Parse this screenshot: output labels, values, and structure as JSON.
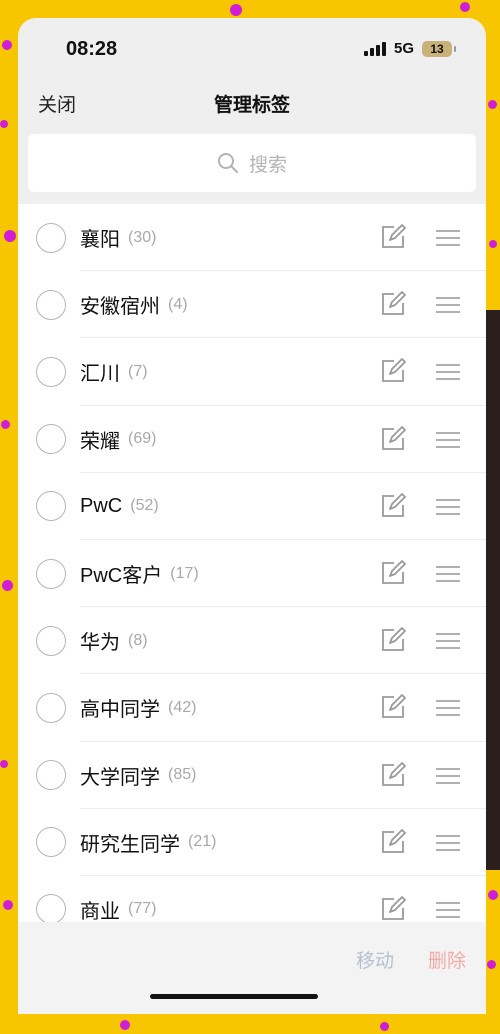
{
  "status_bar": {
    "time": "08:28",
    "network": "5G",
    "battery": "13"
  },
  "nav": {
    "close_label": "关闭",
    "title": "管理标签"
  },
  "search": {
    "placeholder": "搜索"
  },
  "tags": [
    {
      "name": "襄阳",
      "count": "(30)"
    },
    {
      "name": "安徽宿州",
      "count": "(4)"
    },
    {
      "name": "汇川",
      "count": "(7)"
    },
    {
      "name": "荣耀",
      "count": "(69)"
    },
    {
      "name": "PwC",
      "count": "(52)"
    },
    {
      "name": "PwC客户",
      "count": "(17)"
    },
    {
      "name": "华为",
      "count": "(8)"
    },
    {
      "name": "高中同学",
      "count": "(42)"
    },
    {
      "name": "大学同学",
      "count": "(85)"
    },
    {
      "name": "研究生同学",
      "count": "(21)"
    },
    {
      "name": "商业",
      "count": "(77)"
    }
  ],
  "actions": {
    "move_label": "移动",
    "delete_label": "删除"
  },
  "colors": {
    "background": "#f7c600",
    "move_disabled": "#b8bfd3",
    "delete_disabled": "#f1aaa6"
  }
}
